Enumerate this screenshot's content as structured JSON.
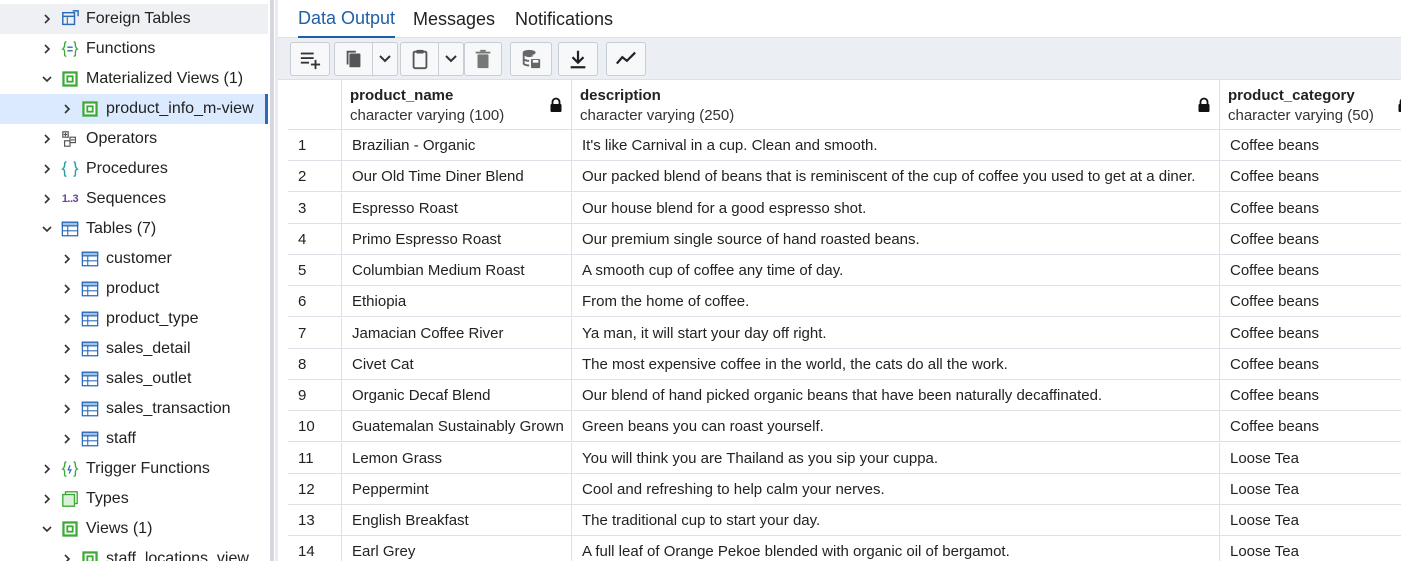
{
  "tree": {
    "items": [
      {
        "label": "Foreign Tables",
        "icon": "foreign-table-icon",
        "chevron": "right",
        "level": 0
      },
      {
        "label": "Functions",
        "icon": "function-icon",
        "chevron": "right",
        "level": 0
      },
      {
        "label": "Materialized Views (1)",
        "icon": "materialized-view-icon",
        "chevron": "down",
        "level": 0
      },
      {
        "label": "product_info_m-view",
        "icon": "materialized-view-icon",
        "chevron": "right",
        "level": 1
      },
      {
        "label": "Operators",
        "icon": "operator-icon",
        "chevron": "right",
        "level": 0
      },
      {
        "label": "Procedures",
        "icon": "procedure-icon",
        "chevron": "right",
        "level": 0
      },
      {
        "label": "Sequences",
        "icon": "sequence-icon",
        "chevron": "right",
        "level": 0,
        "icon_text": "1..3"
      },
      {
        "label": "Tables (7)",
        "icon": "table-icon",
        "chevron": "down",
        "level": 0
      },
      {
        "label": "customer",
        "icon": "table-icon",
        "chevron": "right",
        "level": 1
      },
      {
        "label": "product",
        "icon": "table-icon",
        "chevron": "right",
        "level": 1
      },
      {
        "label": "product_type",
        "icon": "table-icon",
        "chevron": "right",
        "level": 1
      },
      {
        "label": "sales_detail",
        "icon": "table-icon",
        "chevron": "right",
        "level": 1
      },
      {
        "label": "sales_outlet",
        "icon": "table-icon",
        "chevron": "right",
        "level": 1
      },
      {
        "label": "sales_transaction",
        "icon": "table-icon",
        "chevron": "right",
        "level": 1
      },
      {
        "label": "staff",
        "icon": "table-icon",
        "chevron": "right",
        "level": 1
      },
      {
        "label": "Trigger Functions",
        "icon": "trigger-function-icon",
        "chevron": "right",
        "level": 0
      },
      {
        "label": "Types",
        "icon": "type-icon",
        "chevron": "right",
        "level": 0
      },
      {
        "label": "Views (1)",
        "icon": "view-icon",
        "chevron": "down",
        "level": 0
      },
      {
        "label": "staff_locations_view",
        "icon": "view-icon",
        "chevron": "right",
        "level": 1
      }
    ]
  },
  "tabs": [
    {
      "label": "Data Output",
      "active": true
    },
    {
      "label": "Messages",
      "active": false
    },
    {
      "label": "Notifications",
      "active": false
    }
  ],
  "toolbar": {
    "buttons": [
      "add-row-icon",
      "copy-icon",
      "chevron-down-icon",
      "paste-icon",
      "chevron-down-icon",
      "delete-icon",
      "save-data-icon",
      "download-icon",
      "graph-icon"
    ]
  },
  "grid": {
    "columns": [
      {
        "name": "product_name",
        "type": "character varying (100)"
      },
      {
        "name": "description",
        "type": "character varying (250)"
      },
      {
        "name": "product_category",
        "type": "character varying (50)"
      }
    ],
    "rows": [
      {
        "n": "1",
        "product_name": "Brazilian - Organic",
        "description": "It's like Carnival in a cup. Clean and smooth.",
        "product_category": "Coffee beans"
      },
      {
        "n": "2",
        "product_name": "Our Old Time Diner Blend",
        "description": "Our packed blend of beans that is reminiscent of the cup of coffee you used to get at a diner.",
        "product_category": "Coffee beans"
      },
      {
        "n": "3",
        "product_name": "Espresso Roast",
        "description": "Our house blend for a good espresso shot.",
        "product_category": "Coffee beans"
      },
      {
        "n": "4",
        "product_name": "Primo Espresso Roast",
        "description": "Our premium single source of hand roasted beans.",
        "product_category": "Coffee beans"
      },
      {
        "n": "5",
        "product_name": "Columbian Medium Roast",
        "description": "A smooth cup of coffee any time of day.",
        "product_category": "Coffee beans"
      },
      {
        "n": "6",
        "product_name": "Ethiopia",
        "description": "From the home of coffee.",
        "product_category": "Coffee beans"
      },
      {
        "n": "7",
        "product_name": "Jamacian Coffee River",
        "description": "Ya man, it will start your day off right.",
        "product_category": "Coffee beans"
      },
      {
        "n": "8",
        "product_name": "Civet Cat",
        "description": "The most expensive coffee in the world, the cats do all the work.",
        "product_category": "Coffee beans"
      },
      {
        "n": "9",
        "product_name": "Organic Decaf Blend",
        "description": "Our blend of hand picked organic beans that have been naturally decaffinated.",
        "product_category": "Coffee beans"
      },
      {
        "n": "10",
        "product_name": "Guatemalan Sustainably Grown",
        "description": "Green beans you can roast yourself.",
        "product_category": "Coffee beans"
      },
      {
        "n": "11",
        "product_name": "Lemon Grass",
        "description": "You will think you are Thailand as you sip your cuppa.",
        "product_category": "Loose Tea"
      },
      {
        "n": "12",
        "product_name": "Peppermint",
        "description": "Cool and refreshing to help calm your nerves.",
        "product_category": "Loose Tea"
      },
      {
        "n": "13",
        "product_name": "English Breakfast",
        "description": "The traditional cup to start your day.",
        "product_category": "Loose Tea"
      },
      {
        "n": "14",
        "product_name": "Earl Grey",
        "description": "A full leaf of Orange Pekoe blended with organic oil of bergamot.",
        "product_category": "Loose Tea"
      }
    ]
  },
  "colors": {
    "accent": "#1f5fa8",
    "tree_icon_green": "#3aaa35",
    "tree_icon_blue": "#2b6ab8",
    "selected_bg": "#dbeafe"
  }
}
